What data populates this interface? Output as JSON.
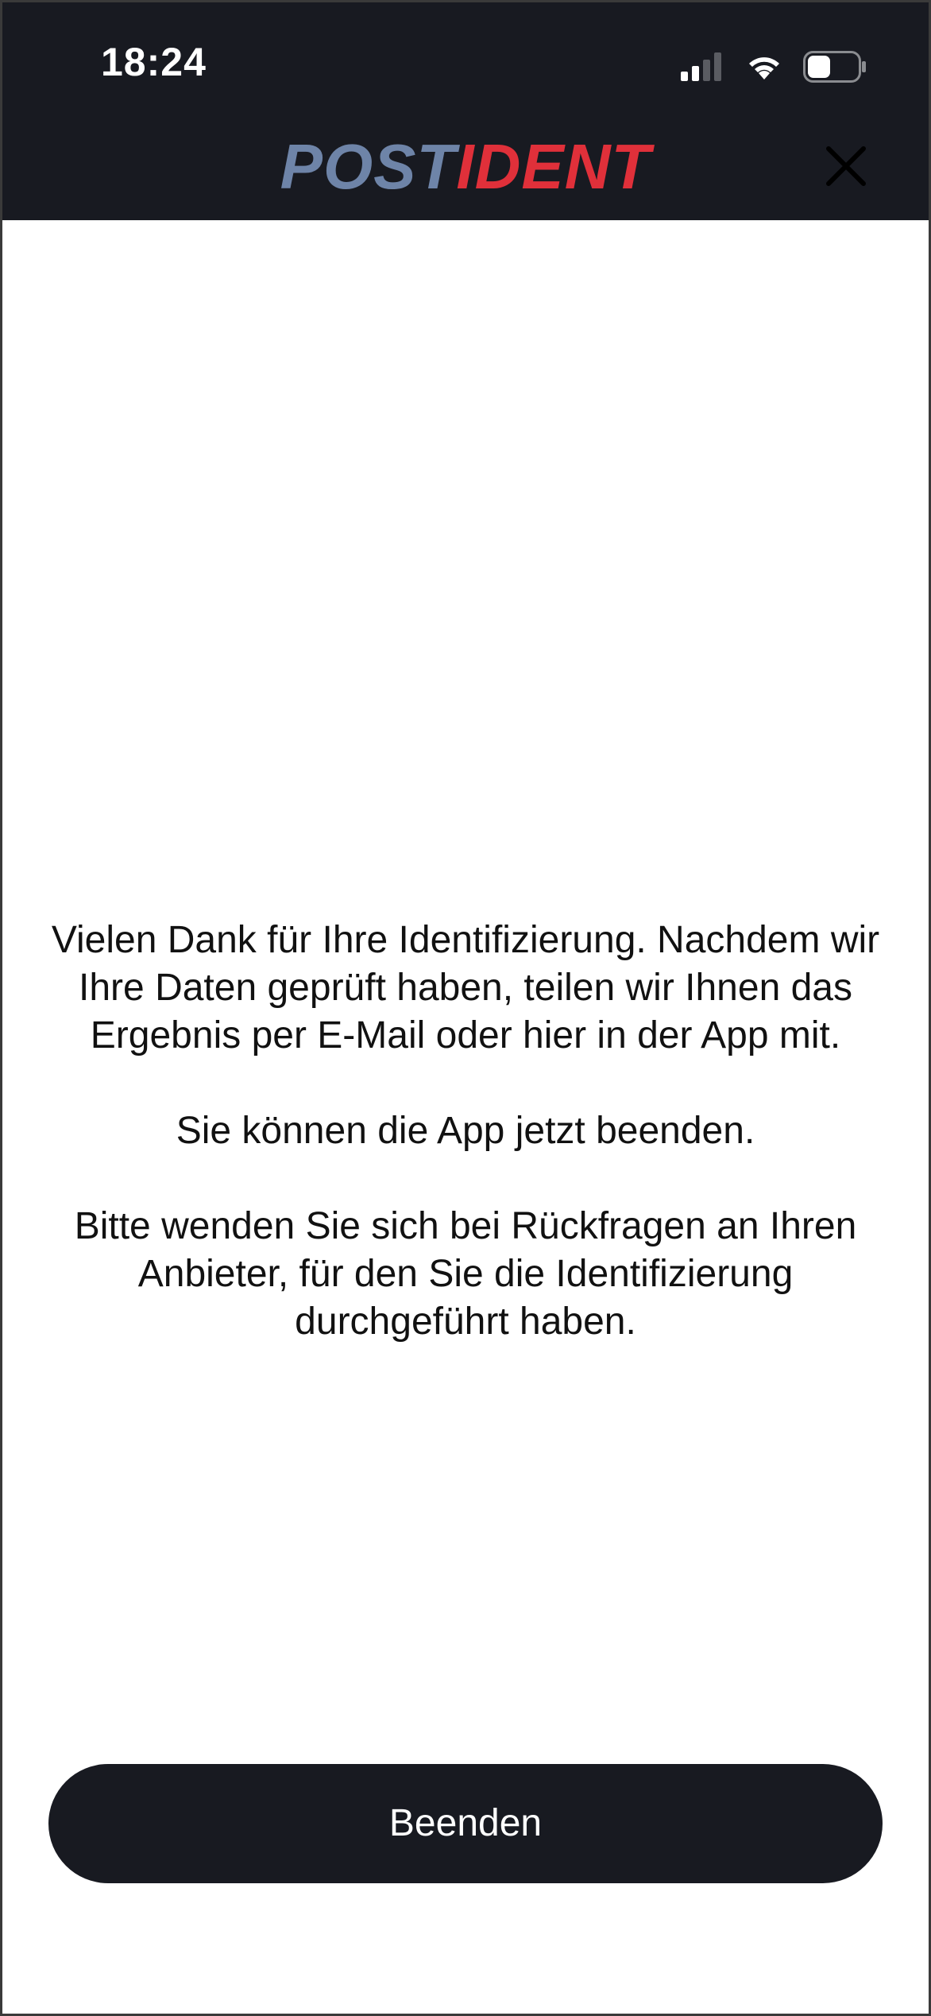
{
  "status_bar": {
    "time": "18:24",
    "signal_bars": 2,
    "signal_total": 4,
    "battery_level": 0.45,
    "icons": [
      "cellular-signal-icon",
      "wifi-icon",
      "battery-icon"
    ]
  },
  "header": {
    "logo_part1": "POST",
    "logo_part2": "IDENT",
    "close_icon": "close-icon"
  },
  "content": {
    "paragraph1": "Vielen Dank für Ihre Identifizierung. Nachdem wir Ihre Daten geprüft haben, teilen wir Ihnen das Ergebnis per E-Mail oder hier in der App mit.",
    "paragraph2": "Sie können die App jetzt beenden.",
    "paragraph3": "Bitte wenden Sie sich bei Rückfragen an Ihren Anbieter, für den Sie die Identifizierung durchgeführt haben."
  },
  "footer": {
    "button_label": "Beenden"
  },
  "colors": {
    "header_bg": "#181a21",
    "logo_post": "#6e84a8",
    "logo_ident": "#e0303a",
    "button_bg": "#181a21",
    "button_text": "#ffffff"
  }
}
